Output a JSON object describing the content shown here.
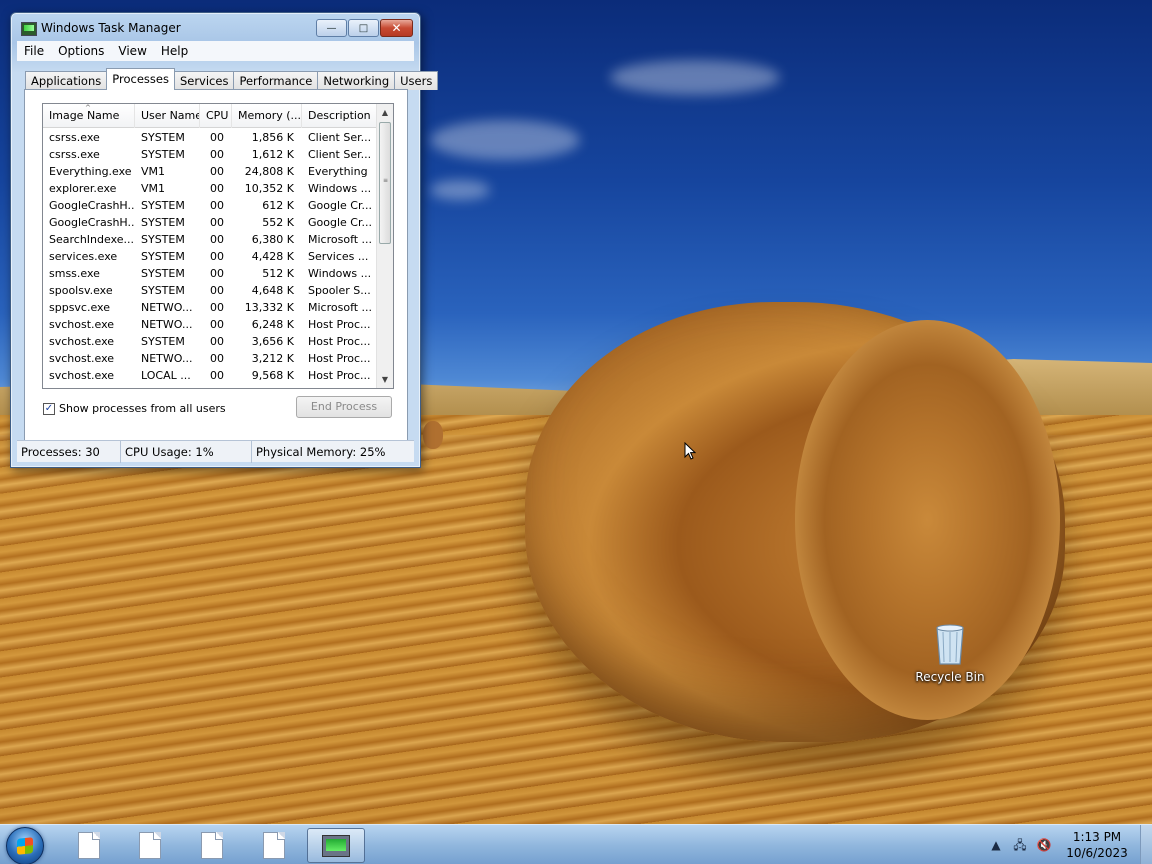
{
  "desktop": {
    "icons": [
      {
        "label": "Recycle Bin",
        "icon": "recycle-bin-icon"
      }
    ]
  },
  "window": {
    "title": "Windows Task Manager",
    "menu": [
      "File",
      "Options",
      "View",
      "Help"
    ],
    "tabs": [
      "Applications",
      "Processes",
      "Services",
      "Performance",
      "Networking",
      "Users"
    ],
    "active_tab": "Processes",
    "columns": [
      "Image Name",
      "User Name",
      "CPU",
      "Memory (...",
      "Description"
    ],
    "rows": [
      {
        "image": "csrss.exe",
        "user": "SYSTEM",
        "cpu": "00",
        "mem": "1,856 K",
        "desc": "Client Ser..."
      },
      {
        "image": "csrss.exe",
        "user": "SYSTEM",
        "cpu": "00",
        "mem": "1,612 K",
        "desc": "Client Ser..."
      },
      {
        "image": "Everything.exe",
        "user": "VM1",
        "cpu": "00",
        "mem": "24,808 K",
        "desc": "Everything"
      },
      {
        "image": "explorer.exe",
        "user": "VM1",
        "cpu": "00",
        "mem": "10,352 K",
        "desc": "Windows ..."
      },
      {
        "image": "GoogleCrashH...",
        "user": "SYSTEM",
        "cpu": "00",
        "mem": "612 K",
        "desc": "Google Cr..."
      },
      {
        "image": "GoogleCrashH...",
        "user": "SYSTEM",
        "cpu": "00",
        "mem": "552 K",
        "desc": "Google Cr..."
      },
      {
        "image": "SearchIndexe...",
        "user": "SYSTEM",
        "cpu": "00",
        "mem": "6,380 K",
        "desc": "Microsoft ..."
      },
      {
        "image": "services.exe",
        "user": "SYSTEM",
        "cpu": "00",
        "mem": "4,428 K",
        "desc": "Services ..."
      },
      {
        "image": "smss.exe",
        "user": "SYSTEM",
        "cpu": "00",
        "mem": "512 K",
        "desc": "Windows ..."
      },
      {
        "image": "spoolsv.exe",
        "user": "SYSTEM",
        "cpu": "00",
        "mem": "4,648 K",
        "desc": "Spooler S..."
      },
      {
        "image": "sppsvc.exe",
        "user": "NETWO...",
        "cpu": "00",
        "mem": "13,332 K",
        "desc": "Microsoft ..."
      },
      {
        "image": "svchost.exe",
        "user": "NETWO...",
        "cpu": "00",
        "mem": "6,248 K",
        "desc": "Host Proc..."
      },
      {
        "image": "svchost.exe",
        "user": "SYSTEM",
        "cpu": "00",
        "mem": "3,656 K",
        "desc": "Host Proc..."
      },
      {
        "image": "svchost.exe",
        "user": "NETWO...",
        "cpu": "00",
        "mem": "3,212 K",
        "desc": "Host Proc..."
      },
      {
        "image": "svchost.exe",
        "user": "LOCAL ...",
        "cpu": "00",
        "mem": "9,568 K",
        "desc": "Host Proc..."
      }
    ],
    "show_all_label": "Show processes from all users",
    "show_all_checked": "✓",
    "end_process_label": "End Process",
    "status": {
      "processes": "Processes: 30",
      "cpu": "CPU Usage: 1%",
      "memory": "Physical Memory: 25%"
    },
    "controls": {
      "minimize": "—",
      "maximize": "□",
      "close": "✕"
    }
  },
  "taskbar": {
    "items": [
      "document-icon",
      "document-icon",
      "document-icon",
      "document-icon",
      "task-manager-icon"
    ],
    "clock_time": "1:13 PM",
    "clock_date": "10/6/2023",
    "tray_expand": "▲",
    "tray_network": "🖧",
    "tray_volume": "🔇"
  },
  "colors": {
    "window_frame": "#a9c6e7",
    "close_button": "#c74a33",
    "taskbar": "#8cb4dc"
  }
}
